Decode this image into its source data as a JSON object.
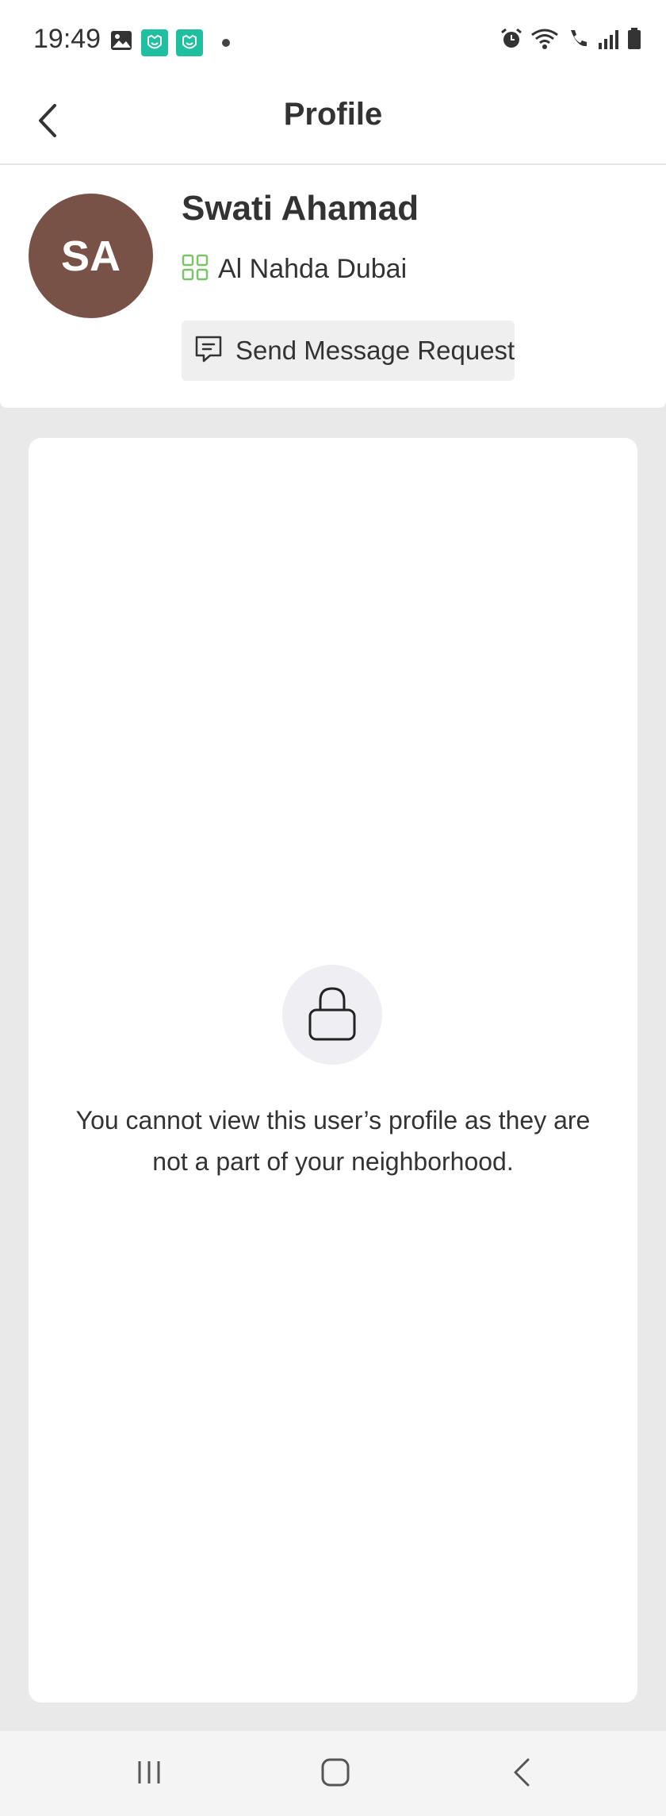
{
  "status_bar": {
    "time": "19:49"
  },
  "app_bar": {
    "title": "Profile",
    "back_icon": "chevron-left-icon"
  },
  "profile": {
    "initials": "SA",
    "avatar_color": "#785246",
    "name": "Swati Ahamad",
    "location": "Al Nahda Dubai",
    "location_icon": "grid-icon",
    "location_icon_color": "#7cc26b",
    "message_button_label": "Send Message Request",
    "message_icon": "chat-bubble-icon"
  },
  "locked_notice": {
    "icon": "lock-icon",
    "message": "You cannot view this user’s profile as they are not a part of your neighborhood."
  },
  "nav_bar": {
    "recents_icon": "recents-icon",
    "home_icon": "home-icon",
    "back_icon": "back-icon"
  }
}
